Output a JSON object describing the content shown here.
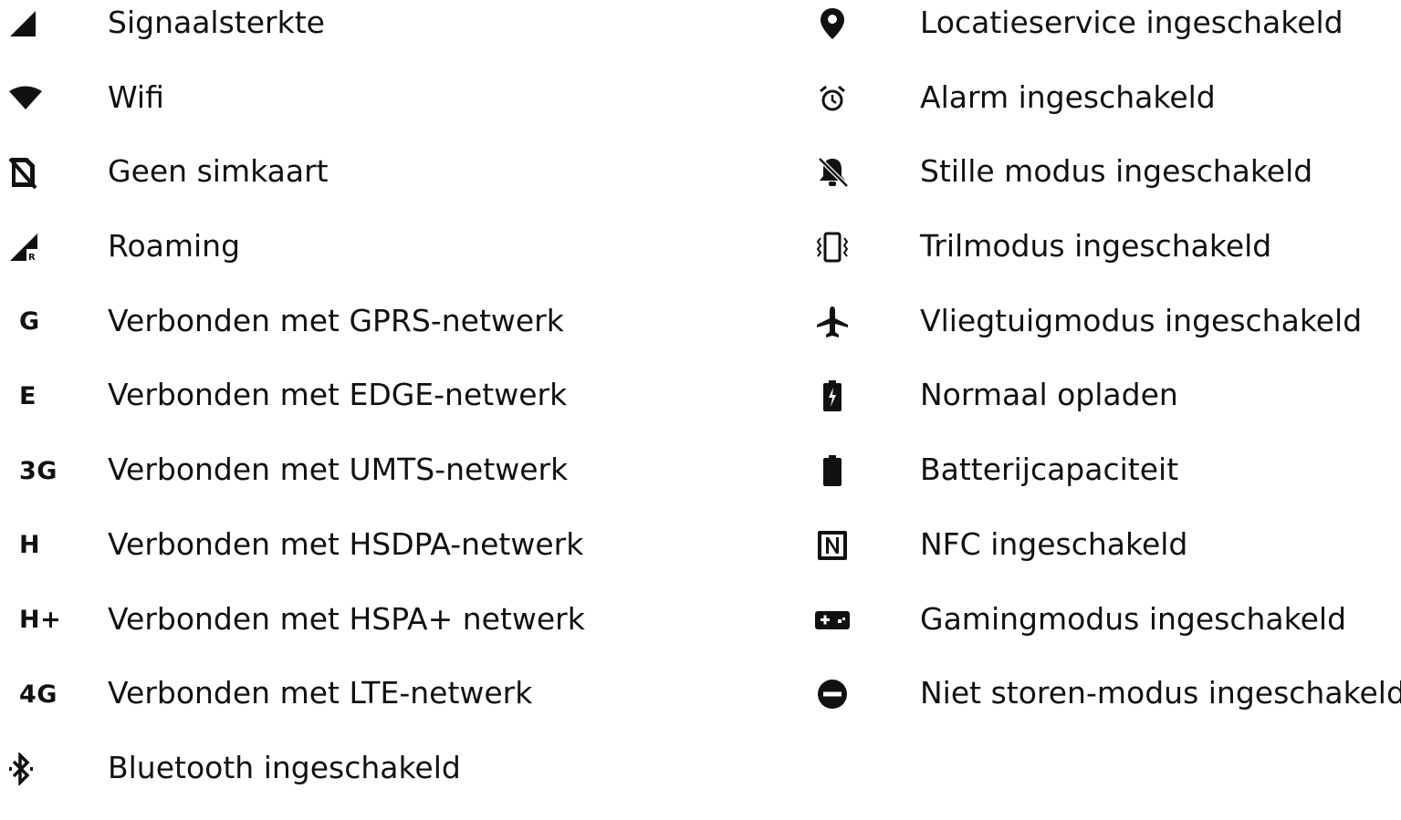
{
  "left_items": [
    {
      "icon": "signal-strength-icon",
      "label": "Signaalsterkte"
    },
    {
      "icon": "wifi-icon",
      "label": "Wifi"
    },
    {
      "icon": "no-sim-icon",
      "label": "Geen simkaart"
    },
    {
      "icon": "roaming-icon",
      "label": "Roaming"
    },
    {
      "icon_text": "G",
      "label": "Verbonden met GPRS-netwerk"
    },
    {
      "icon_text": "E",
      "label": "Verbonden met EDGE-netwerk"
    },
    {
      "icon_text": "3G",
      "label": "Verbonden met UMTS-netwerk"
    },
    {
      "icon_text": "H",
      "label": "Verbonden met HSDPA-netwerk"
    },
    {
      "icon_text": "H+",
      "label": "Verbonden met HSPA+ netwerk"
    },
    {
      "icon_text": "4G",
      "label": "Verbonden met LTE-netwerk"
    },
    {
      "icon": "bluetooth-icon",
      "label": "Bluetooth ingeschakeld"
    }
  ],
  "right_items": [
    {
      "icon": "location-pin-icon",
      "label": "Locatieservice ingeschakeld"
    },
    {
      "icon": "alarm-clock-icon",
      "label": "Alarm ingeschakeld"
    },
    {
      "icon": "bell-off-icon",
      "label": "Stille modus ingeschakeld"
    },
    {
      "icon": "vibrate-icon",
      "label": "Trilmodus ingeschakeld"
    },
    {
      "icon": "airplane-icon",
      "label": "Vliegtuigmodus ingeschakeld"
    },
    {
      "icon": "battery-charging-icon",
      "label": "Normaal opladen"
    },
    {
      "icon": "battery-full-icon",
      "label": "Batterijcapaciteit"
    },
    {
      "icon": "nfc-icon",
      "label": "NFC ingeschakeld"
    },
    {
      "icon": "gamepad-icon",
      "label": "Gamingmodus ingeschakeld"
    },
    {
      "icon": "do-not-disturb-icon",
      "label": "Niet storen-modus ingeschakeld"
    }
  ]
}
